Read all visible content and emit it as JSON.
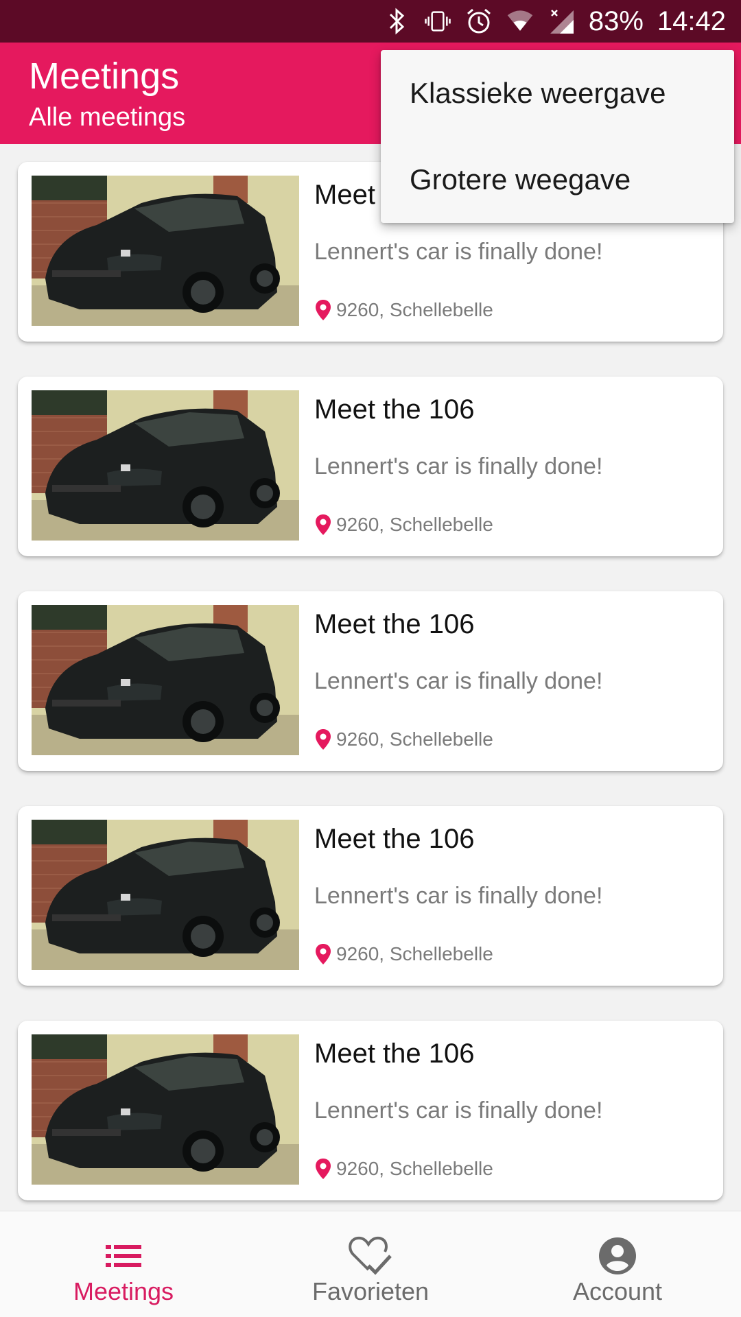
{
  "status_bar": {
    "battery": "83%",
    "time": "14:42",
    "icons": [
      "bluetooth-icon",
      "vibrate-icon",
      "alarm-icon",
      "wifi-icon",
      "signal-icon"
    ]
  },
  "app_bar": {
    "title": "Meetings",
    "subtitle": "Alle meetings"
  },
  "menu": {
    "items": [
      {
        "label": "Klassieke weergave"
      },
      {
        "label": "Grotere weegave"
      }
    ]
  },
  "meetings": [
    {
      "title": "Meet the 106",
      "description": "Lennert's car is finally done!",
      "location": "9260, Schellebelle"
    },
    {
      "title": "Meet the 106",
      "description": "Lennert's car is finally done!",
      "location": "9260, Schellebelle"
    },
    {
      "title": "Meet the 106",
      "description": "Lennert's car is finally done!",
      "location": "9260, Schellebelle"
    },
    {
      "title": "Meet the 106",
      "description": "Lennert's car is finally done!",
      "location": "9260, Schellebelle"
    },
    {
      "title": "Meet the 106",
      "description": "Lennert's car is finally done!",
      "location": "9260, Schellebelle"
    }
  ],
  "bottom_nav": {
    "items": [
      {
        "label": "Meetings",
        "icon": "list-icon",
        "active": true
      },
      {
        "label": "Favorieten",
        "icon": "heart-check-icon",
        "active": false
      },
      {
        "label": "Account",
        "icon": "account-icon",
        "active": false
      }
    ]
  },
  "colors": {
    "status_bar": "#5c0a26",
    "primary": "#e5195e",
    "accent": "#d81b60"
  }
}
